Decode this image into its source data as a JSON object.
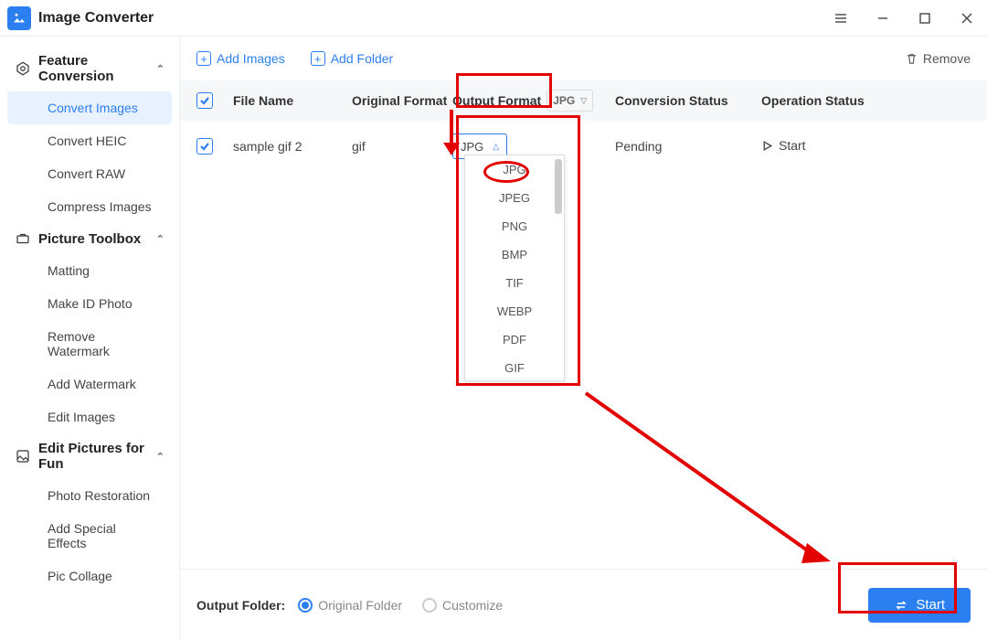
{
  "app": {
    "title": "Image Converter"
  },
  "window": {
    "menu": "≡",
    "minimize": "—",
    "maximize": "☐",
    "close": "✕"
  },
  "sidebar": {
    "sections": [
      {
        "title": "Feature Conversion",
        "items": [
          "Convert Images",
          "Convert HEIC",
          "Convert RAW",
          "Compress Images"
        ],
        "active_index": 0
      },
      {
        "title": "Picture Toolbox",
        "items": [
          "Matting",
          "Make ID Photo",
          "Remove Watermark",
          "Add Watermark",
          "Edit Images"
        ]
      },
      {
        "title": "Edit Pictures for Fun",
        "items": [
          "Photo Restoration",
          "Add Special Effects",
          "Pic Collage"
        ]
      }
    ]
  },
  "toolbar": {
    "add_images": "Add Images",
    "add_folder": "Add Folder",
    "remove": "Remove"
  },
  "table": {
    "headers": {
      "file_name": "File Name",
      "original_format": "Original Format",
      "output_format": "Output Format",
      "output_global": "JPG",
      "conversion_status": "Conversion Status",
      "operation_status": "Operation Status"
    },
    "rows": [
      {
        "checked": true,
        "file_name": "sample gif 2",
        "original_format": "gif",
        "output_format": "JPG",
        "conversion_status": "Pending",
        "operation": "Start"
      }
    ]
  },
  "dropdown": {
    "options": [
      "JPG",
      "JPEG",
      "PNG",
      "BMP",
      "TIF",
      "WEBP",
      "PDF",
      "GIF"
    ]
  },
  "footer": {
    "label": "Output Folder:",
    "radio_original": "Original Folder",
    "radio_custom": "Customize",
    "start": "Start"
  }
}
